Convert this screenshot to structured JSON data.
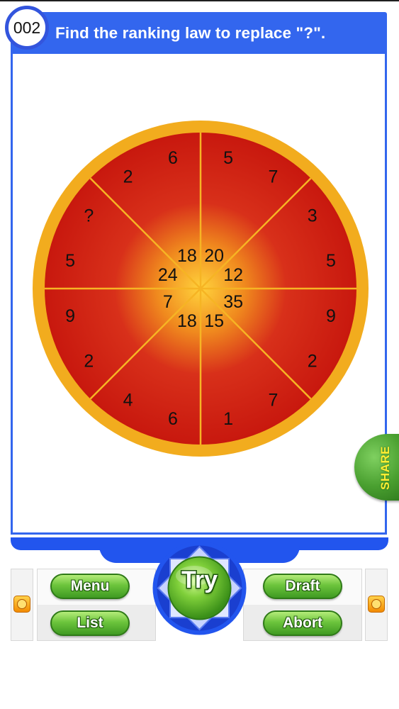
{
  "header": {
    "level": "002",
    "question": "Find the ranking law to replace \"?\"."
  },
  "wheel": {
    "outer_pairs": [
      {
        "a": "6",
        "b": "5"
      },
      {
        "a": "7",
        "b": "3"
      },
      {
        "a": "5",
        "b": "9"
      },
      {
        "a": "2",
        "b": "7"
      },
      {
        "a": "1",
        "b": "6"
      },
      {
        "a": "4",
        "b": "2"
      },
      {
        "a": "9",
        "b": "5"
      },
      {
        "a": "?",
        "b": "2"
      }
    ],
    "inner": [
      "20",
      "12",
      "35",
      "15",
      "18",
      "7",
      "24",
      "18"
    ]
  },
  "share": {
    "label": "SHARE"
  },
  "controls": {
    "menu": "Menu",
    "list": "List",
    "try": "Try",
    "draft": "Draft",
    "abort": "Abort"
  },
  "colors": {
    "header_blue": "#3366ee",
    "wheel_rim": "#f0a81c",
    "wheel_red": "#cc1a10",
    "wheel_center": "#ffd23c",
    "button_green": "#6cc43c"
  },
  "icons": [
    "left-arrow-icon",
    "right-arrow-icon",
    "try-gem-icon"
  ]
}
